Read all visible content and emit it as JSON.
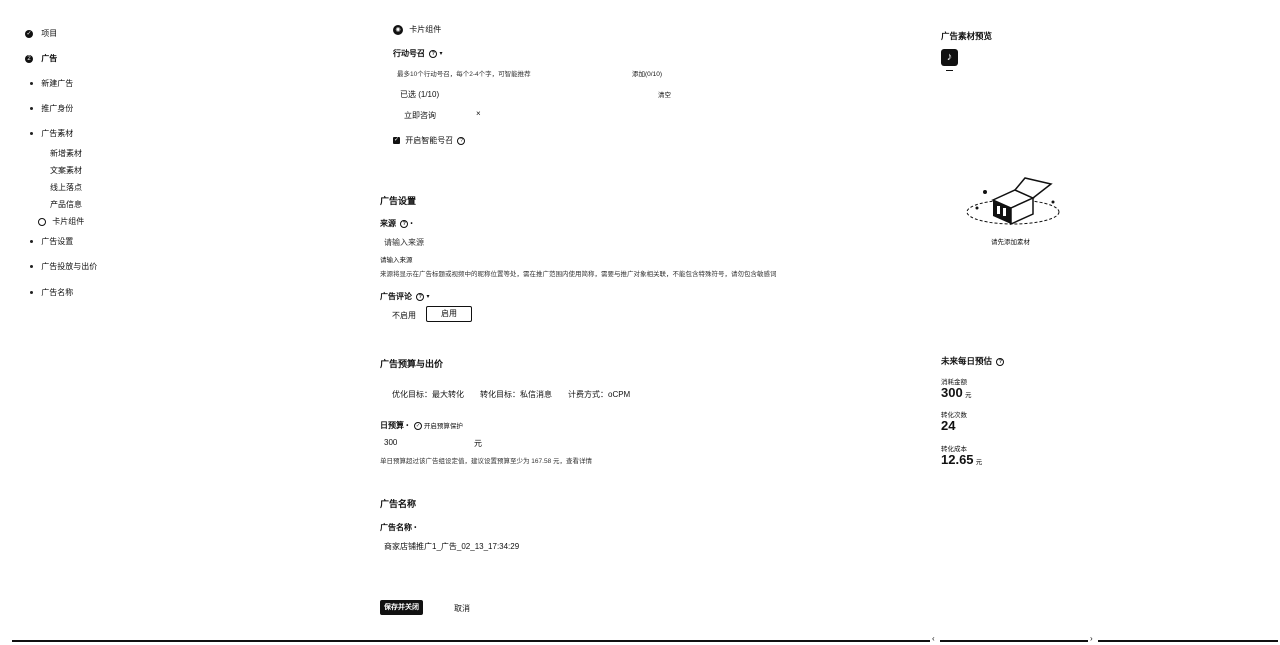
{
  "sidebar": {
    "project": "项目",
    "ad": "广告",
    "items": [
      "新建广告",
      "推广身份",
      "广告素材",
      "广告设置",
      "广告投放与出价",
      "广告名称"
    ],
    "sub_items": [
      "新增素材",
      "文案素材",
      "线上落点",
      "产品信息",
      "卡片组件"
    ]
  },
  "creative": {
    "card_label": "卡片组件",
    "action_label": "行动号召",
    "action_hint": "最多10个行动号召，每个2-4个字，可智能推荐",
    "add_link": "添加(0/10)",
    "selected": "已选 (1/10)",
    "clear": "清空",
    "tag": "立即咨询",
    "tag_close": "×",
    "smart_label": "开启智能号召"
  },
  "ad_settings": {
    "title": "广告设置",
    "source_label": "来源",
    "source_placeholder": "请输入来源",
    "source_hint": "请输入来源",
    "source_desc": "来源将显示在广告标题或视频中的昵称位置等处，需在推广范围内使用简称，需要与推广对象相关联，不能包含特殊符号，请勿包含敏感词",
    "comment_label": "广告评论",
    "comment_off": "不启用",
    "comment_on": "启用"
  },
  "budget": {
    "title": "广告预算与出价",
    "summary": "优化目标：最大转化　　转化目标：私信消息　　计费方式：oCPM",
    "daily_label": "日预算",
    "daily_link": "开启预算保护",
    "daily_value": "300",
    "unit": "元",
    "daily_hint": "单日预算超过该广告组设定值，建议设置预算至少为 167.58 元，查看详情"
  },
  "naming": {
    "title": "广告名称",
    "label": "广告名称",
    "value": "商家店铺推广1_广告_02_13_17:34:29"
  },
  "footer": {
    "save": "保存并关闭",
    "cancel": "取消"
  },
  "preview": {
    "title": "广告素材预览",
    "empty": "请先添加素材"
  },
  "forecast": {
    "title": "未来每日预估",
    "spend_label": "消耗金额",
    "spend_value": "300",
    "spend_unit": "元",
    "conv_label": "转化次数",
    "conv_value": "24",
    "cpa_label": "转化成本",
    "cpa_value": "12.65",
    "cpa_unit": "元"
  },
  "icons": {
    "check": "check-circle-icon",
    "step2": "step-2-icon",
    "tiktok": "tiktok-icon",
    "help": "help-icon"
  }
}
